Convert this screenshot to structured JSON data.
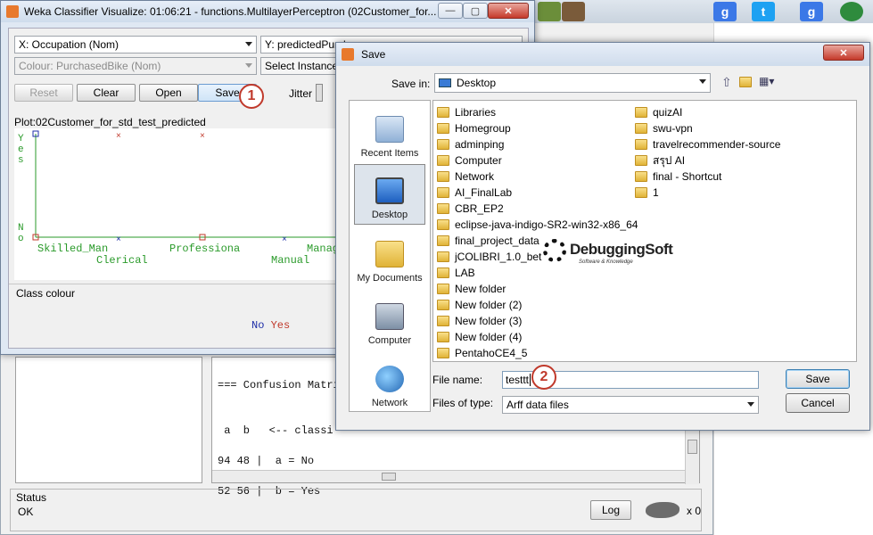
{
  "visualizer": {
    "title": "Weka Classifier Visualize: 01:06:21 - functions.MultilayerPerceptron (02Customer_for...",
    "x_axis_select": "X: Occupation (Nom)",
    "y_axis_select": "Y: predictedPurch",
    "colour_select": "Colour: PurchasedBike (Nom)",
    "select_instance": "Select Instance",
    "buttons": {
      "reset": "Reset",
      "clear": "Clear",
      "open": "Open",
      "save": "Save"
    },
    "jitter_label": "Jitter",
    "plot_title": "Plot:02Customer_for_std_test_predicted",
    "y_labels": {
      "top": "Y\ne\ns",
      "bottom": "N\no"
    },
    "x_categories_row1": [
      "Skilled_Man",
      "Professiona",
      "Manag"
    ],
    "x_categories_row2": [
      "Clerical",
      "Manual"
    ],
    "class_colour_label": "Class colour",
    "class_legend": [
      {
        "label": "No",
        "color": "#1f2fa8"
      },
      {
        "label": "Yes",
        "color": "#c0392b"
      }
    ]
  },
  "annotations": {
    "one": "1",
    "two": "2"
  },
  "output": {
    "line1": "=== Confusion Matri",
    "line2": " a  b   <-- classi",
    "line3": "94 48 |  a = No",
    "line4": "52 56 |  b = Yes"
  },
  "status": {
    "label": "Status",
    "text": "OK",
    "log_button": "Log",
    "count": "x 0"
  },
  "save_dialog": {
    "title": "Save",
    "save_in_label": "Save in:",
    "save_in_value": "Desktop",
    "places": [
      "Recent Items",
      "Desktop",
      "My Documents",
      "Computer",
      "Network"
    ],
    "files_col1": [
      "Libraries",
      "Homegroup",
      "adminping",
      "Computer",
      "Network",
      "AI_FinalLab",
      "CBR_EP2",
      "eclipse-java-indigo-SR2-win32-x86_64",
      "final_project_data",
      "jCOLIBRI_1.0_bet",
      "LAB",
      "New folder",
      "New folder (2)",
      "New folder (3)",
      "New folder (4)",
      "PentahoCE4_5"
    ],
    "files_col2": [
      "quizAI",
      "swu-vpn",
      "travelrecommender-source",
      "สรุป AI",
      "final - Shortcut",
      "1"
    ],
    "file_name_label": "File name:",
    "file_name_value": "testtt",
    "files_of_type_label": "Files of type:",
    "files_of_type_value": "Arff data files",
    "save_button": "Save",
    "cancel_button": "Cancel"
  },
  "watermark": {
    "name": "DebuggingSoft",
    "tagline": "Software & Knowledge"
  }
}
